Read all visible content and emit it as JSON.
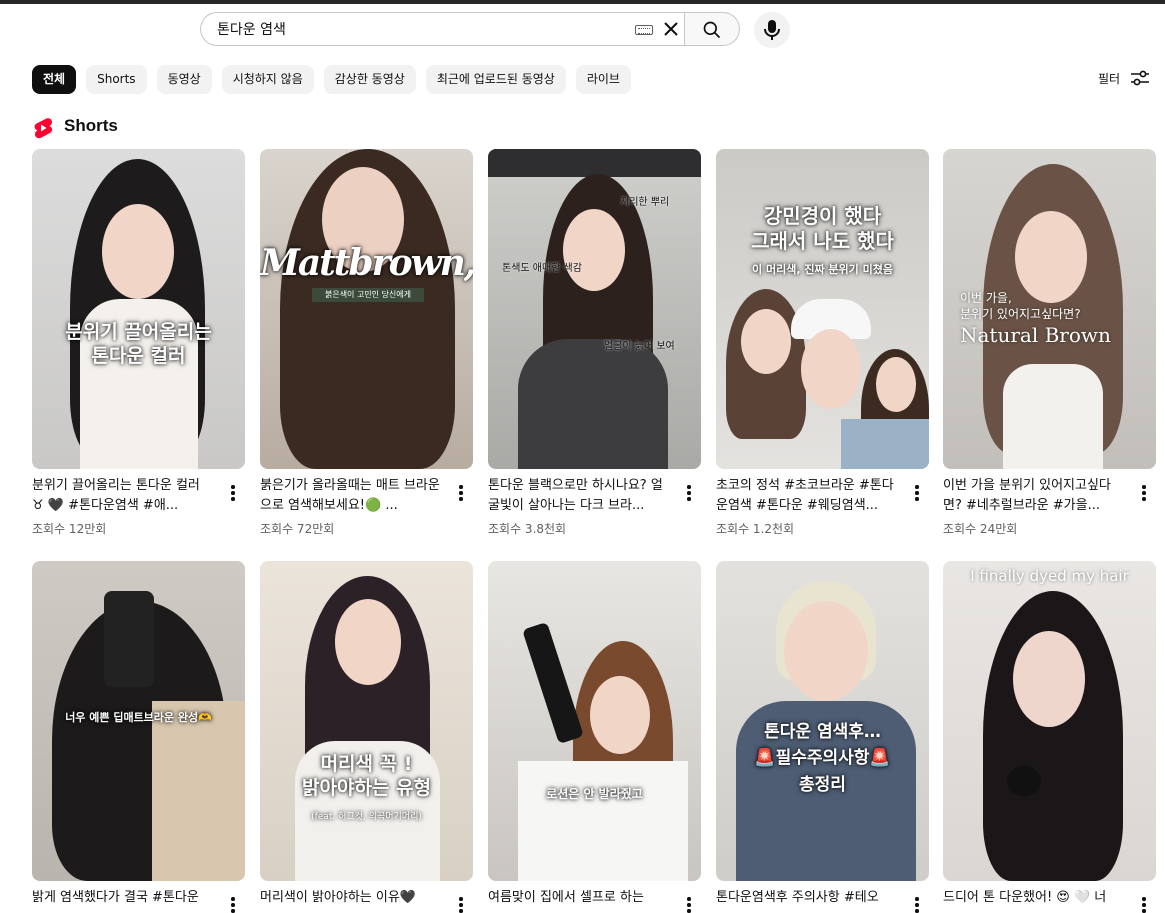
{
  "search": {
    "value": "톤다운 염색"
  },
  "chips": [
    "전체",
    "Shorts",
    "동영상",
    "시청하지 않음",
    "감상한 동영상",
    "최근에 업로드된 동영상",
    "라이브"
  ],
  "filter_label": "필터",
  "section_title": "Shorts",
  "icons": [
    "keyboard-icon",
    "clear-icon",
    "search-icon",
    "mic-icon",
    "filter-icon",
    "shorts-logo-icon",
    "more-vert-icon"
  ],
  "colors": {
    "active_chip": "#0f0f0f",
    "shorts_red": "#ff0033",
    "views_gray": "#606060"
  },
  "cards": [
    {
      "title": "분위기 끌어올리는 톤다운 컬러 ♉ 🖤 #톤다운염색 #애...",
      "views": "조회수 12만회",
      "overlay": "분위기 끌어올리는\n톤다운 컬러"
    },
    {
      "title": "붉은기가 올라올때는 매트 브라운으로 염색해보세요!🟢 ...",
      "views": "조회수 72만회",
      "overlay": "Mattbrown,"
    },
    {
      "title": "톤다운 블랙으로만 하시나요? 얼굴빛이 살아나는 다크 브라...",
      "views": "조회수 3.8천회",
      "overlay": ""
    },
    {
      "title": "초코의 정석 #초코브라운 #톤다운염색 #톤다운 #웨딩염색...",
      "views": "조회수 1.2천회",
      "overlay": "강민경이 했다\n그래서 나도 했다"
    },
    {
      "title": "이번 가을 분위기 있어지고싶다면? #네추럴브라운 #가을...",
      "views": "조회수 24만회",
      "overlay": "Natural Brown"
    },
    {
      "title": "밝게 염색했다가 결국 #톤다운",
      "views": "",
      "overlay": "너우 예쁜 딥매트브라운 완성🫶"
    },
    {
      "title": "머리색이 밝아야하는 이유🖤",
      "views": "",
      "overlay": "머리색 꼭 !\n밝아야하는 유형"
    },
    {
      "title": "여름맞이 집에서 셀프로 하는",
      "views": "",
      "overlay": "로션은 안 발라줬고"
    },
    {
      "title": "톤다운염색후 주의사항 #테오",
      "views": "",
      "overlay": "톤다운 염색후…\n🚨필수주의사항🚨\n총정리"
    },
    {
      "title": "드디어 톤 다운했어! 😍 🤍 너",
      "views": "",
      "overlay": "I finally dyed my hair"
    }
  ],
  "thumb_extras": {
    "c2_sub": "붉은색이 고민인 당신에게",
    "c4_sub": "이 머리색, 진짜 분위기 미쳤음",
    "c5_sub": "이번 가을,\n분위기 있어지고싶다면?",
    "c3_notes": [
      "지리한 뿌리",
      "톤색도 애매한 색감",
      "얼굴이 늙어 보여"
    ],
    "c7_sub": "(feat. 허그컷, 의곡머기머리)"
  }
}
